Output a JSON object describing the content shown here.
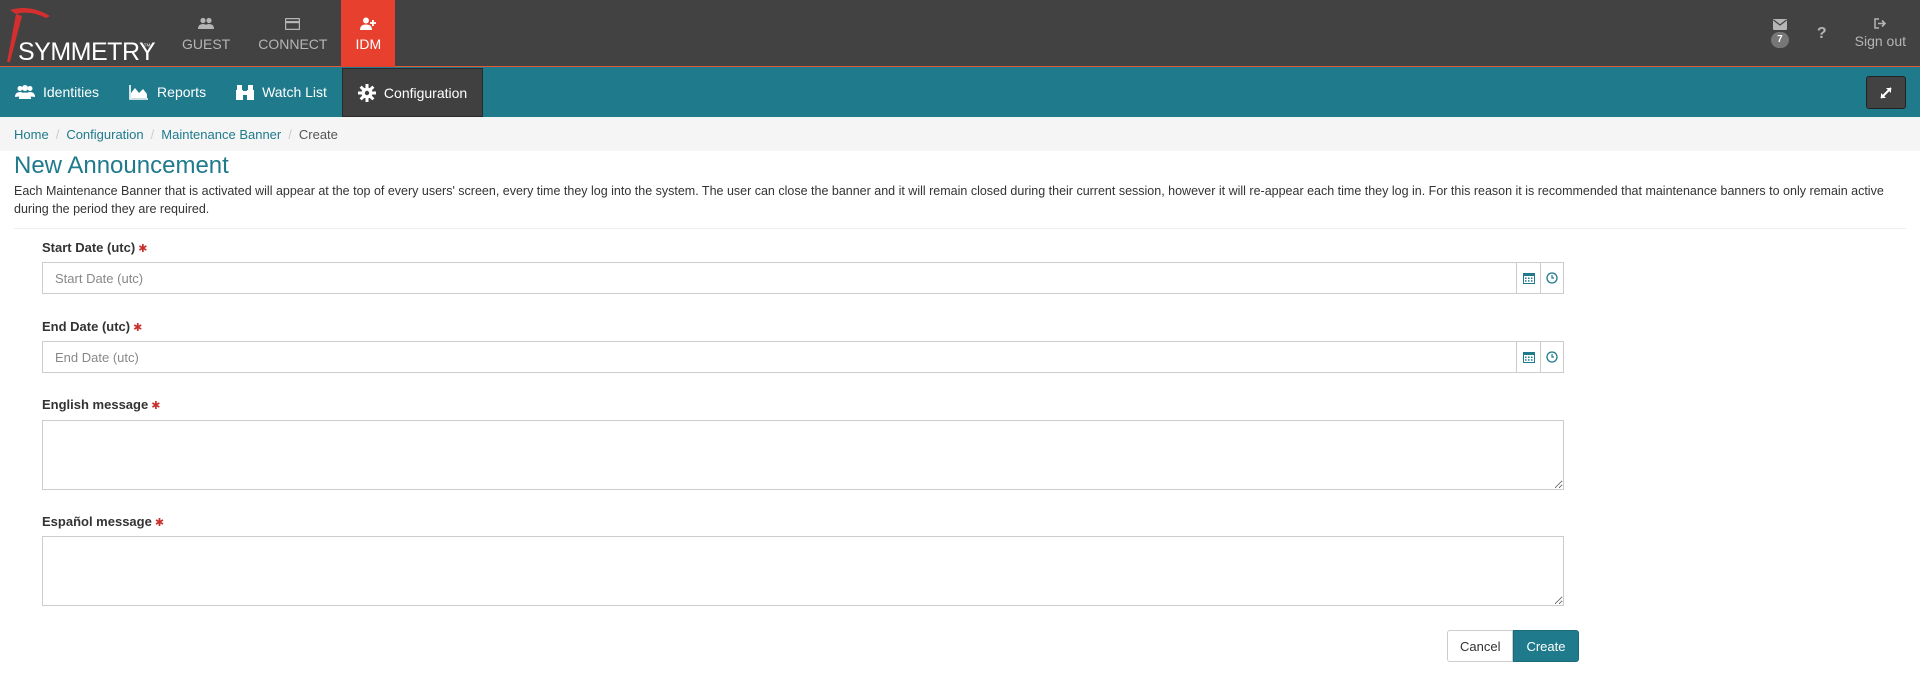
{
  "brand": {
    "name": "SYMMETRY",
    "tm": "™"
  },
  "topnav": [
    {
      "label": "GUEST",
      "icon": "users-icon"
    },
    {
      "label": "CONNECT",
      "icon": "card-icon"
    },
    {
      "label": "IDM",
      "icon": "user-plus-icon",
      "active": true
    }
  ],
  "topright": {
    "messages_count": "7",
    "help": "?",
    "signout": "Sign out"
  },
  "subnav": [
    {
      "label": "Identities",
      "icon": "users-icon"
    },
    {
      "label": "Reports",
      "icon": "area-chart-icon"
    },
    {
      "label": "Watch List",
      "icon": "binoculars-icon"
    },
    {
      "label": "Configuration",
      "icon": "gear-icon",
      "active": true
    }
  ],
  "breadcrumb": {
    "home": "Home",
    "configuration": "Configuration",
    "maintenance_banner": "Maintenance Banner",
    "current": "Create",
    "sep": "/"
  },
  "page": {
    "title": "New Announcement",
    "description": "Each Maintenance Banner that is activated will appear at the top of every users' screen, every time they log into the system. The user can close the banner and it will remain closed during their current session, however it will re-appear each time they log in. For this reason it is recommended that maintenance banners to only remain active during the period they are required."
  },
  "form": {
    "start_date": {
      "label": "Start Date (utc)",
      "placeholder": "Start Date (utc)",
      "required": "✱"
    },
    "end_date": {
      "label": "End Date (utc)",
      "placeholder": "End Date (utc)",
      "required": "✱"
    },
    "english_message": {
      "label": "English message",
      "required": "✱"
    },
    "espanol_message": {
      "label": "Español message",
      "required": "✱"
    }
  },
  "buttons": {
    "cancel": "Cancel",
    "create": "Create"
  },
  "colors": {
    "topbar": "#424242",
    "accent": "#1f7a8c",
    "active_red": "#e8402e",
    "required": "#c9302c"
  }
}
